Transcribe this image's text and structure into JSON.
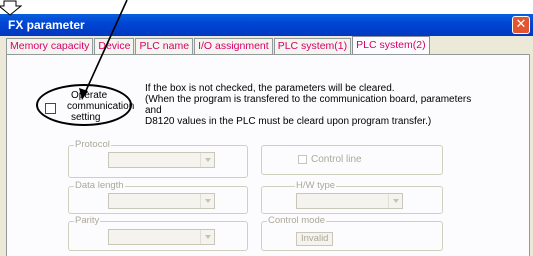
{
  "window": {
    "title": "FX parameter"
  },
  "tabs": [
    {
      "label": "Memory capacity"
    },
    {
      "label": "Device"
    },
    {
      "label": "PLC name"
    },
    {
      "label": "I/O assignment"
    },
    {
      "label": "PLC system(1)"
    },
    {
      "label": "PLC system(2)"
    }
  ],
  "active_tab": "PLC system(2)",
  "operate_checkbox": {
    "checked": false,
    "label_lines": [
      "Operate",
      "communication",
      "setting"
    ]
  },
  "info_lines": [
    "If the box is not checked, the parameters will be cleared.",
    "(When the program is transfered to the communication board, parameters and",
    "D8120 values in the PLC must be cleard upon program transfer.)"
  ],
  "groups": {
    "protocol": {
      "label": "Protocol"
    },
    "control_line": {
      "label": "Control line",
      "checked": false
    },
    "data_length": {
      "label": "Data length"
    },
    "hw_type": {
      "label": "H/W type"
    },
    "parity": {
      "label": "Parity"
    },
    "control_mode": {
      "label": "Control mode",
      "value": "Invalid"
    }
  }
}
